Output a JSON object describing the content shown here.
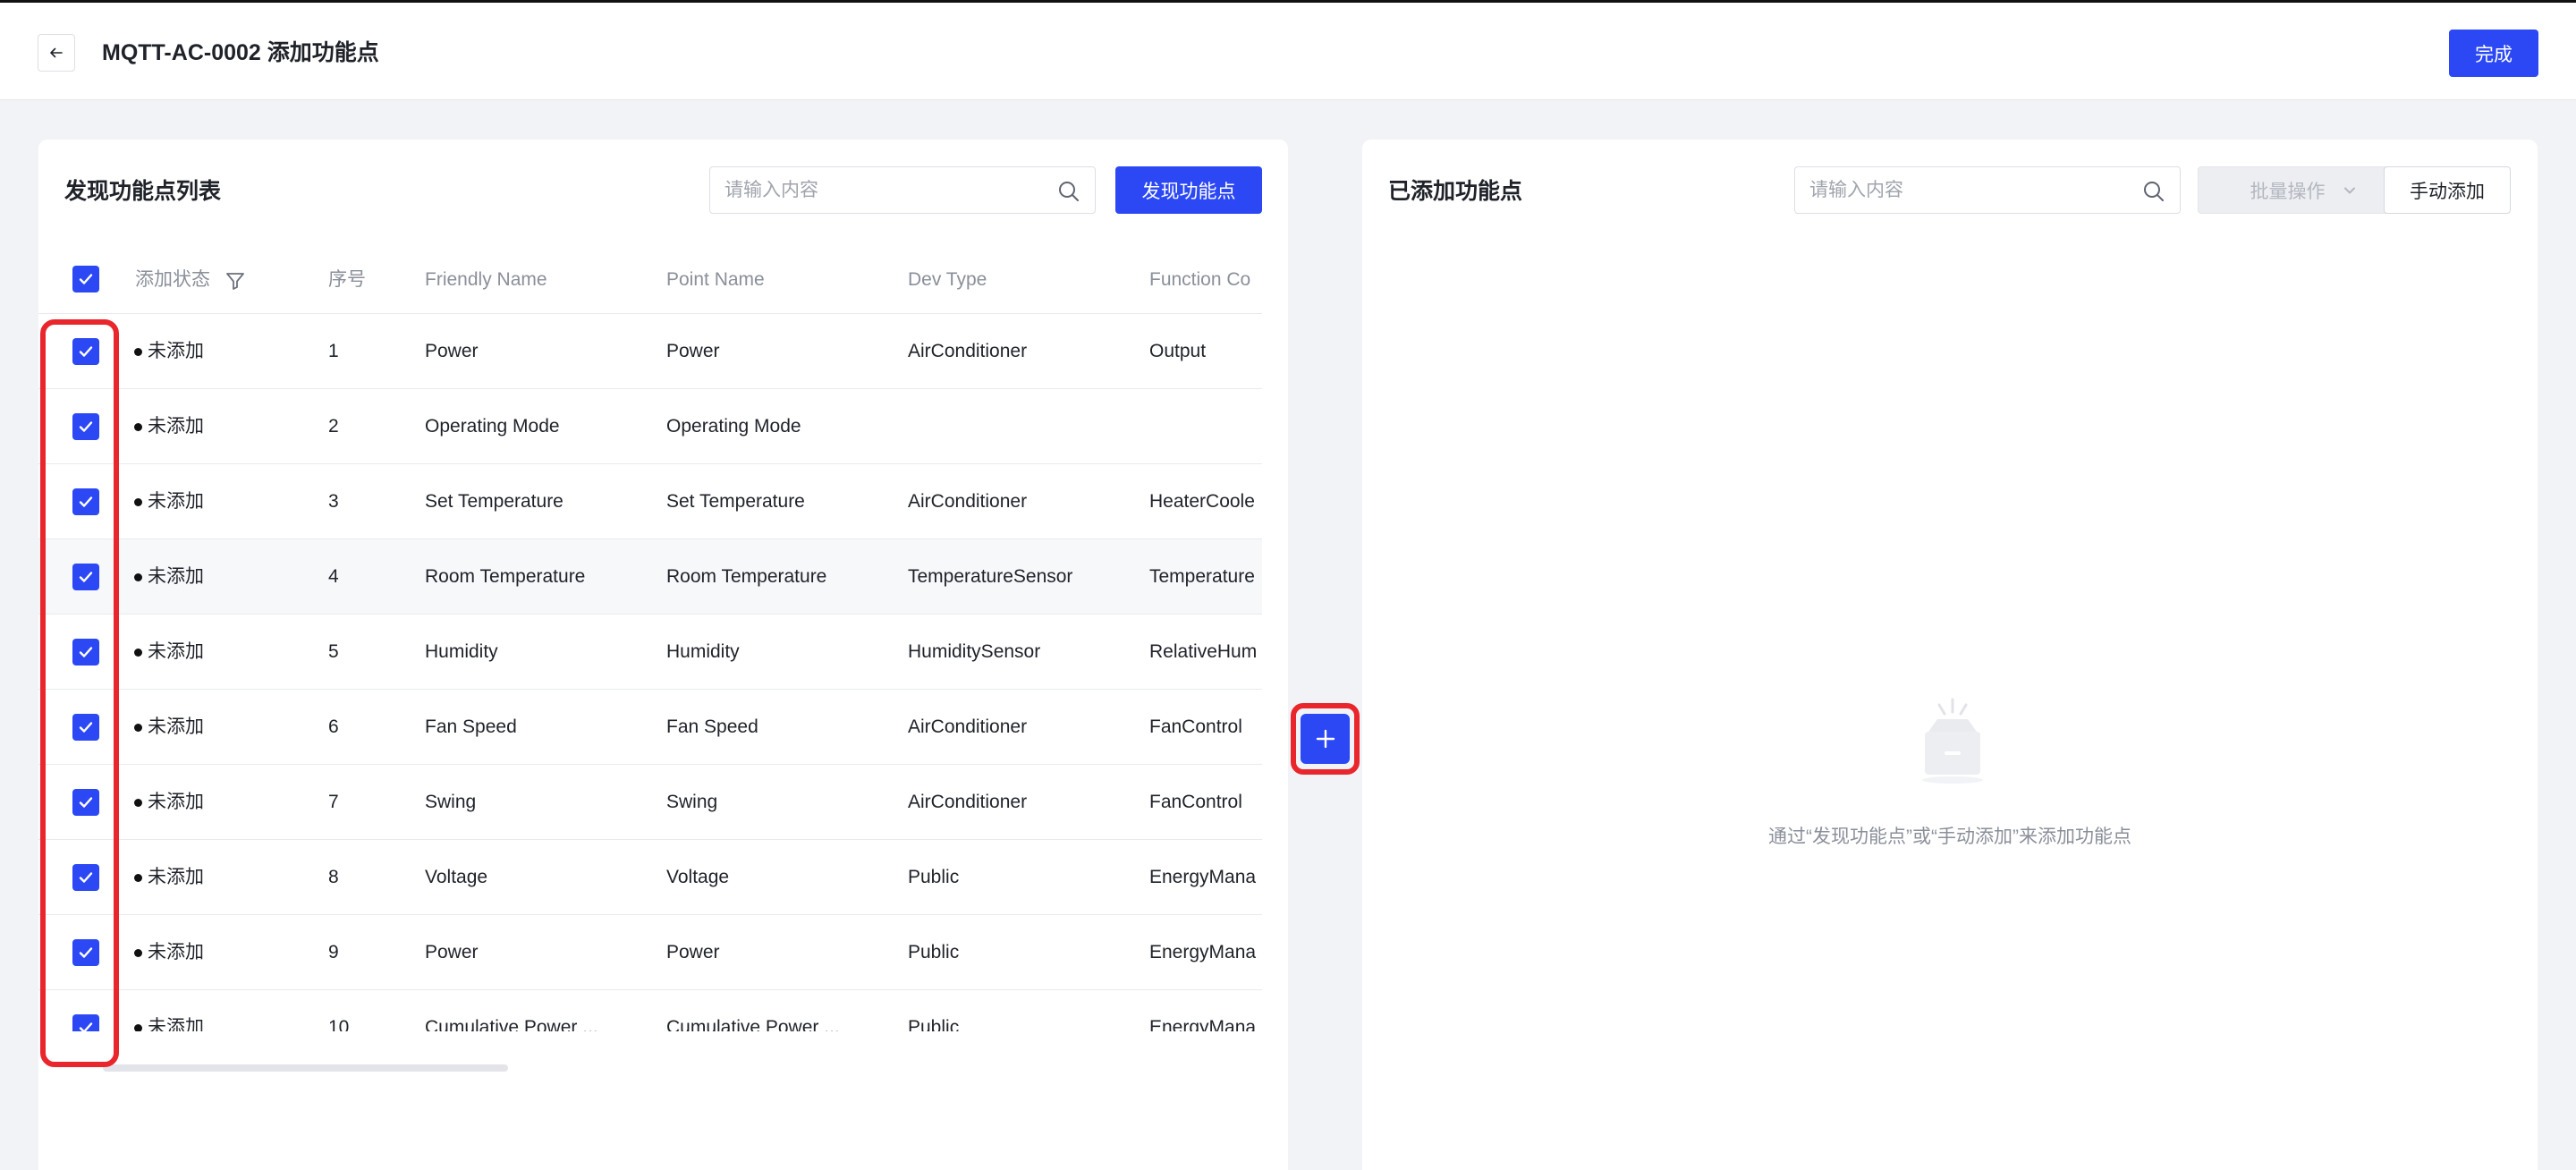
{
  "header": {
    "title": "MQTT-AC-0002 添加功能点",
    "done_label": "完成"
  },
  "left_panel": {
    "title": "发现功能点列表",
    "search_placeholder": "请输入内容",
    "discover_label": "发现功能点",
    "columns": {
      "status": "添加状态",
      "index": "序号",
      "friendly_name": "Friendly Name",
      "point_name": "Point Name",
      "dev_type": "Dev Type",
      "function_code": "Function Co"
    },
    "rows": [
      {
        "checked": true,
        "status": "未添加",
        "index": "1",
        "friendly_name": "Power",
        "point_name": "Power",
        "dev_type": "AirConditioner",
        "function_code": "Output"
      },
      {
        "checked": true,
        "status": "未添加",
        "index": "2",
        "friendly_name": "Operating Mode",
        "point_name": "Operating Mode",
        "dev_type": "",
        "function_code": ""
      },
      {
        "checked": true,
        "status": "未添加",
        "index": "3",
        "friendly_name": "Set Temperature",
        "point_name": "Set Temperature",
        "dev_type": "AirConditioner",
        "function_code": "HeaterCoole"
      },
      {
        "checked": true,
        "status": "未添加",
        "index": "4",
        "friendly_name": "Room Temperature",
        "point_name": "Room Temperature",
        "dev_type": "TemperatureSensor",
        "function_code": "Temperature"
      },
      {
        "checked": true,
        "status": "未添加",
        "index": "5",
        "friendly_name": "Humidity",
        "point_name": "Humidity",
        "dev_type": "HumiditySensor",
        "function_code": "RelativeHum"
      },
      {
        "checked": true,
        "status": "未添加",
        "index": "6",
        "friendly_name": "Fan Speed",
        "point_name": "Fan Speed",
        "dev_type": "AirConditioner",
        "function_code": "FanControl"
      },
      {
        "checked": true,
        "status": "未添加",
        "index": "7",
        "friendly_name": "Swing",
        "point_name": "Swing",
        "dev_type": "AirConditioner",
        "function_code": "FanControl"
      },
      {
        "checked": true,
        "status": "未添加",
        "index": "8",
        "friendly_name": "Voltage",
        "point_name": "Voltage",
        "dev_type": "Public",
        "function_code": "EnergyMana"
      },
      {
        "checked": true,
        "status": "未添加",
        "index": "9",
        "friendly_name": "Power",
        "point_name": "Power",
        "dev_type": "Public",
        "function_code": "EnergyMana"
      },
      {
        "checked": true,
        "status": "未添加",
        "index": "10",
        "friendly_name": "Cumulative Power ...",
        "point_name": "Cumulative Power ...",
        "dev_type": "Public",
        "function_code": "EnergyMana"
      }
    ]
  },
  "right_panel": {
    "title": "已添加功能点",
    "search_placeholder": "请输入内容",
    "batch_label": "批量操作",
    "manual_add_label": "手动添加",
    "empty_text": "通过“发现功能点”或“手动添加”来添加功能点"
  },
  "colors": {
    "primary": "#2c48f5",
    "highlight_red": "#e8262b",
    "background": "#f2f3f6"
  },
  "icons": [
    "back-arrow-icon",
    "search-icon",
    "filter-icon",
    "check-icon",
    "plus-icon",
    "chevron-down-icon",
    "empty-box-icon"
  ]
}
